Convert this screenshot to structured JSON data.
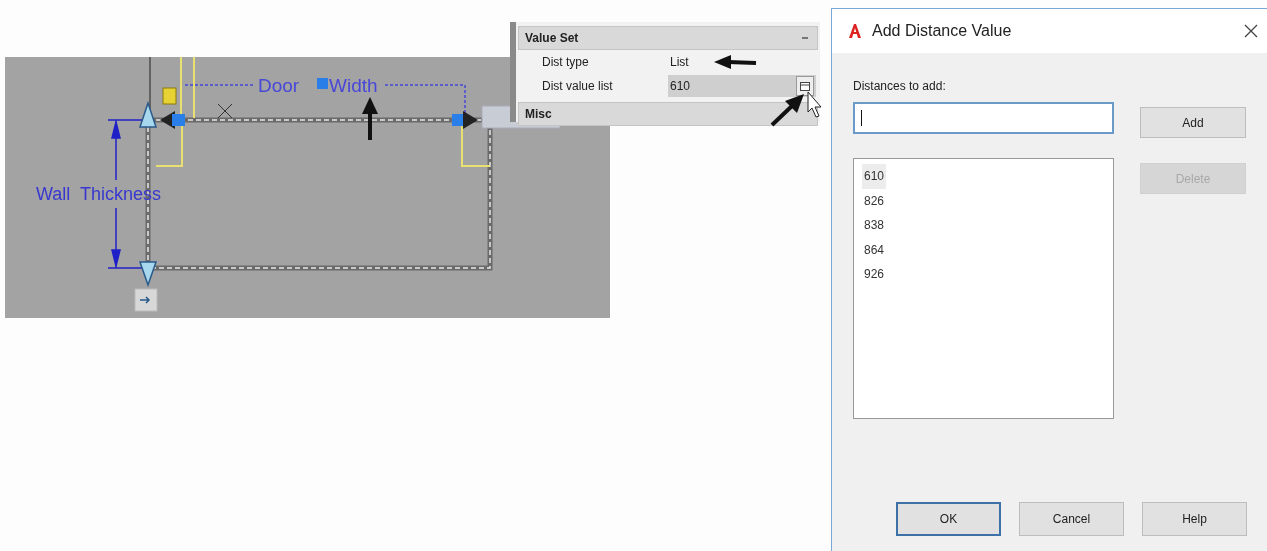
{
  "drawing": {
    "door_label": "Door",
    "width_label": "Width",
    "wall_label": "Wall  Thickness"
  },
  "properties": {
    "value_set": {
      "title": "Value Set",
      "expanded": true,
      "rows": [
        {
          "name": "Dist type",
          "value": "List",
          "kind": "text"
        },
        {
          "name": "Dist value list",
          "value": "610",
          "kind": "ellipsis"
        }
      ]
    },
    "misc_title": "Misc"
  },
  "dialog": {
    "title": "Add Distance Value",
    "input_label": "Distances to add:",
    "input_focused": true,
    "side_buttons": [
      {
        "label": "Add",
        "disabled": false
      },
      {
        "label": "Delete",
        "disabled": true
      }
    ],
    "distances": [
      {
        "text": "610",
        "selected": true
      },
      {
        "text": "826",
        "selected": false
      },
      {
        "text": "838",
        "selected": false
      },
      {
        "text": "864",
        "selected": false
      },
      {
        "text": "926",
        "selected": false
      }
    ],
    "buttons": [
      {
        "label": "OK",
        "default": true
      },
      {
        "label": "Cancel",
        "default": false
      },
      {
        "label": "Help",
        "default": false
      }
    ]
  }
}
